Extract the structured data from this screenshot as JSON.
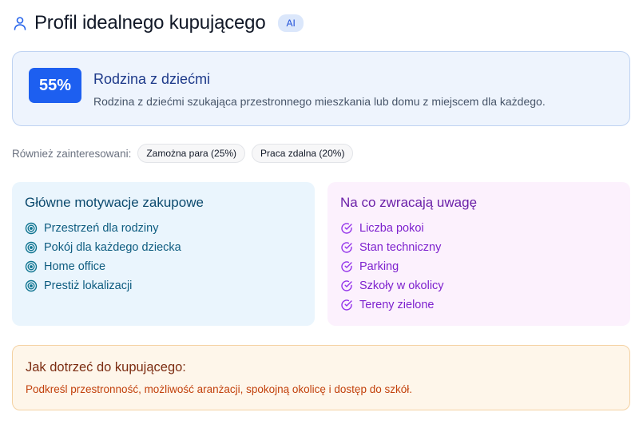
{
  "header": {
    "title": "Profil idealnego kupującego",
    "badge": "AI",
    "icon": "user-icon"
  },
  "primary": {
    "percent": "55%",
    "title": "Rodzina z dziećmi",
    "description": "Rodzina z dziećmi szukająca przestronnego mieszkania lub domu z miejscem dla każdego."
  },
  "also": {
    "label": "Również zainteresowani:",
    "tags": [
      "Zamożna para (25%)",
      "Praca zdalna (20%)"
    ]
  },
  "motivations": {
    "title": "Główne motywacje zakupowe",
    "icon": "target-icon",
    "items": [
      "Przestrzeń dla rodziny",
      "Pokój dla każdego dziecka",
      "Home office",
      "Prestiż lokalizacji"
    ]
  },
  "attention": {
    "title": "Na co zwracają uwagę",
    "icon": "check-circle-icon",
    "items": [
      "Liczba pokoi",
      "Stan techniczny",
      "Parking",
      "Szkoły w okolicy",
      "Tereny zielone"
    ]
  },
  "reach": {
    "title": "Jak dotrzeć do kupującego:",
    "description": "Podkreśl przestronność, możliwość aranżacji, spokojną okolicę i dostęp do szkół."
  },
  "colors": {
    "accent": "#1d5ff0",
    "motivations_bg": "#eaf5fd",
    "attention_bg": "#fcf1fd",
    "reach_bg": "#fef6ea"
  }
}
